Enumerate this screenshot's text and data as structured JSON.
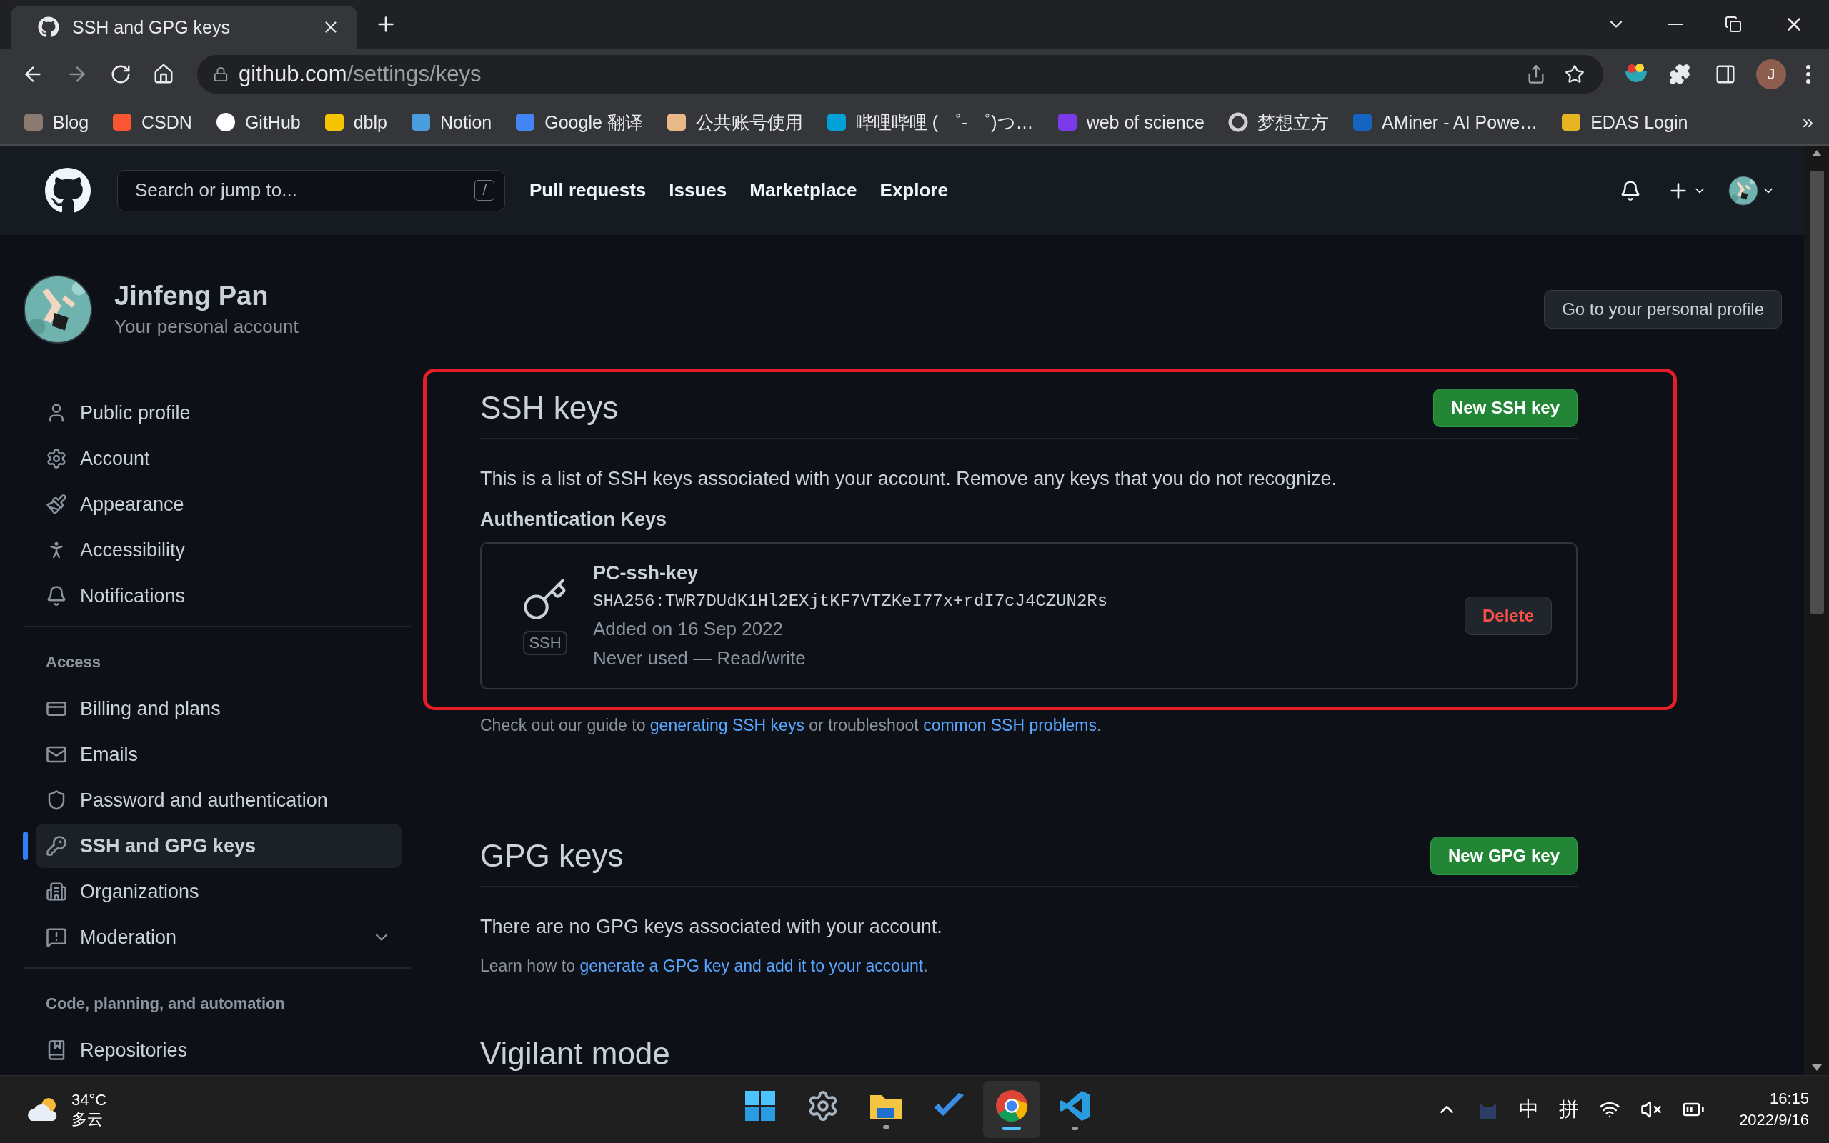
{
  "browser": {
    "tab_title": "SSH and GPG keys",
    "url_host": "github.com",
    "url_path": "/settings/keys",
    "profile_initial": "J",
    "bookmarks": [
      {
        "label": "Blog"
      },
      {
        "label": "CSDN"
      },
      {
        "label": "GitHub"
      },
      {
        "label": "dblp"
      },
      {
        "label": "Notion"
      },
      {
        "label": "Google 翻译"
      },
      {
        "label": "公共账号使用"
      },
      {
        "label": "哔哩哔哩 ( ゜- ゜)つ…"
      },
      {
        "label": "web of science"
      },
      {
        "label": "梦想立方"
      },
      {
        "label": "AMiner - AI Powe…"
      },
      {
        "label": "EDAS Login"
      }
    ],
    "bookmarks_more": "»"
  },
  "header": {
    "search_placeholder": "Search or jump to...",
    "search_shortcut": "/",
    "nav": [
      "Pull requests",
      "Issues",
      "Marketplace",
      "Explore"
    ]
  },
  "profile": {
    "name": "Jinfeng Pan",
    "subtitle": "Your personal account",
    "button": "Go to your personal profile"
  },
  "sidebar": {
    "sections": [
      {
        "items": [
          {
            "label": "Public profile",
            "selected": false
          },
          {
            "label": "Account",
            "selected": false
          },
          {
            "label": "Appearance",
            "selected": false
          },
          {
            "label": "Accessibility",
            "selected": false
          },
          {
            "label": "Notifications",
            "selected": false
          }
        ]
      },
      {
        "heading": "Access",
        "items": [
          {
            "label": "Billing and plans",
            "selected": false
          },
          {
            "label": "Emails",
            "selected": false
          },
          {
            "label": "Password and authentication",
            "selected": false
          },
          {
            "label": "SSH and GPG keys",
            "selected": true
          },
          {
            "label": "Organizations",
            "selected": false
          },
          {
            "label": "Moderation",
            "selected": false,
            "expanded": false
          }
        ]
      },
      {
        "heading": "Code, planning, and automation",
        "items": [
          {
            "label": "Repositories",
            "selected": false
          }
        ]
      }
    ]
  },
  "ssh": {
    "title": "SSH keys",
    "button": "New SSH key",
    "description": "This is a list of SSH keys associated with your account. Remove any keys that you do not recognize.",
    "subheading": "Authentication Keys",
    "keys": [
      {
        "name": "PC-ssh-key",
        "fingerprint": "SHA256:TWR7DUdK1Hl2EXjtKF7VTZKeI77x+rdI7cJ4CZUN2Rs",
        "badge": "SSH",
        "added": "Added on 16 Sep 2022",
        "usage": "Never used — Read/write",
        "action": "Delete"
      }
    ],
    "guide": [
      {
        "text": "Check out our guide to ",
        "link": false
      },
      {
        "text": "generating SSH keys",
        "link": true
      },
      {
        "text": " or troubleshoot ",
        "link": false
      },
      {
        "text": "common SSH problems",
        "link": true
      },
      {
        "text": ".",
        "link": false
      }
    ]
  },
  "gpg": {
    "title": "GPG keys",
    "button": "New GPG key",
    "empty": "There are no GPG keys associated with your account.",
    "learn": [
      {
        "text": "Learn how to ",
        "link": false
      },
      {
        "text": "generate a GPG key and add it to your account",
        "link": true
      },
      {
        "text": ".",
        "link": false
      }
    ]
  },
  "vigilant": {
    "title": "Vigilant mode"
  },
  "taskbar": {
    "weather": {
      "temperature": "34°C",
      "condition": "多云"
    },
    "apps": [
      {
        "selected": false,
        "running": false
      },
      {
        "selected": false,
        "running": false
      },
      {
        "selected": false,
        "running": true
      },
      {
        "selected": false,
        "running": false
      },
      {
        "selected": true,
        "running": true
      },
      {
        "selected": false,
        "running": true
      }
    ],
    "ime": [
      "中",
      "拼"
    ],
    "clock": {
      "time": "16:15",
      "date": "2022/9/16"
    }
  }
}
